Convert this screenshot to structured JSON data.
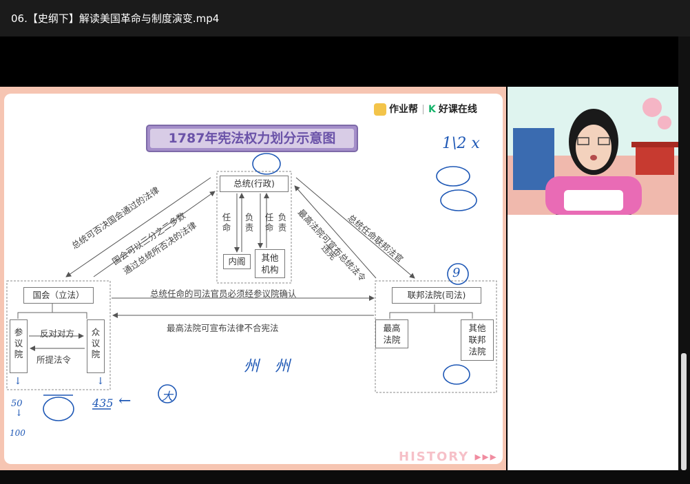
{
  "window": {
    "title": "06.【史纲下】解读美国革命与制度演变.mp4"
  },
  "brand": {
    "app1": "作业帮",
    "app2": "好课在线"
  },
  "slide": {
    "title": "1787年宪法权力划分示意图",
    "president": "总统(行政)",
    "appoint": "任命",
    "responsible": "负责",
    "cabinet": "内阁",
    "other_agencies": "其他机构",
    "congress": "国会（立法）",
    "senate": "参议院",
    "house": "众议院",
    "oppose": "反对对方",
    "propose": "所提法令",
    "federal_court": "联邦法院(司法)",
    "supreme_court": "最高法院",
    "other_courts": "其他联邦法院",
    "veto": "总统可否决国会通过的法律",
    "override_l1": "国会可以三分之二多数",
    "override_l2": "通过总统所否决的法律",
    "court_vs_pres_l1": "最高法院可宣布总统法令",
    "court_vs_pres_l2": "违宪",
    "pres_appoints_judges": "总统任命联邦法官",
    "senate_confirm": "总统任命的司法官员必须经参议院确认",
    "court_vs_law": "最高法院可宣布法律不合宪法",
    "watermark": "HISTORY"
  },
  "annotations": {
    "ratio": "1\\2 x",
    "nine": "9",
    "arrow_down": "↓",
    "num_50": "50",
    "num_100": "100",
    "num_435": "435",
    "left_arrow": "←",
    "circle_big": "大",
    "state": "州 州"
  },
  "colors": {
    "accent": "#a48ec9",
    "ink": "#1d57b5",
    "frame": "#f6c5b2"
  }
}
